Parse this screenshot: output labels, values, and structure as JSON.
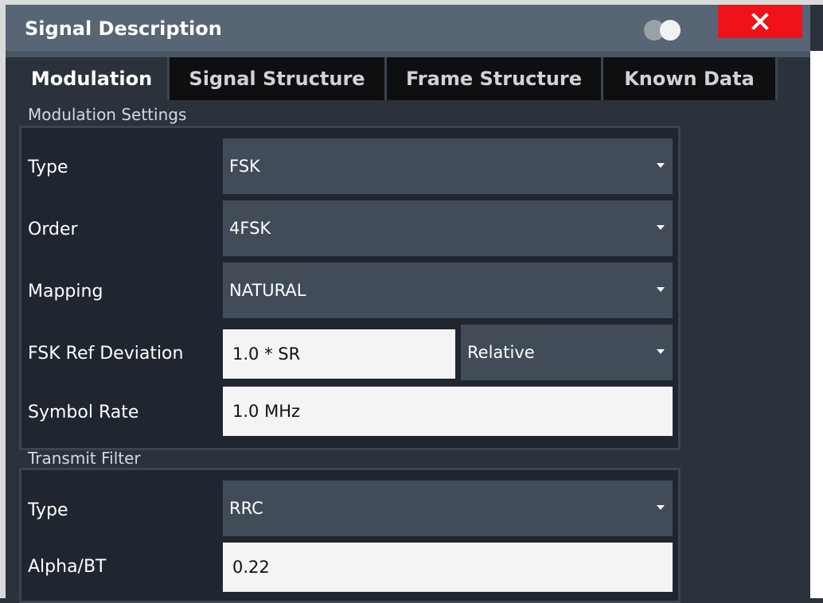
{
  "dialog": {
    "title": "Signal Description"
  },
  "tabs": [
    {
      "label": "Modulation",
      "active": true
    },
    {
      "label": "Signal Structure",
      "active": false
    },
    {
      "label": "Frame Structure",
      "active": false
    },
    {
      "label": "Known Data",
      "active": false
    }
  ],
  "modulation_settings": {
    "group_label": "Modulation Settings",
    "type": {
      "label": "Type",
      "value": "FSK"
    },
    "order": {
      "label": "Order",
      "value": "4FSK"
    },
    "mapping": {
      "label": "Mapping",
      "value": "NATURAL"
    },
    "fsk_ref_deviation": {
      "label": "FSK Ref Deviation",
      "value": "1.0 * SR",
      "mode": "Relative"
    },
    "symbol_rate": {
      "label": "Symbol Rate",
      "value": "1.0 MHz"
    }
  },
  "transmit_filter": {
    "group_label": "Transmit Filter",
    "type": {
      "label": "Type",
      "value": "RRC"
    },
    "alpha_bt": {
      "label": "Alpha/BT",
      "value": "0.22"
    }
  },
  "colors": {
    "titlebar": "#586574",
    "background": "#2b323c",
    "close_button": "#f0111a",
    "dropdown": "#424b58",
    "field": "#f4f4f4"
  },
  "icons": {
    "close": "close-icon",
    "toggle": "toggle-icon",
    "dropdown": "chevron-down-icon"
  }
}
